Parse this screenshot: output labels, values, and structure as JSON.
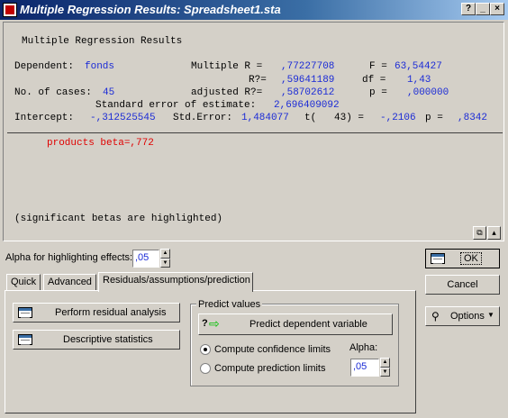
{
  "window": {
    "title": "Multiple Regression Results: Spreadsheet1.sta",
    "buttons": {
      "help": "?",
      "minimize": "_",
      "close": "×"
    }
  },
  "output": {
    "heading": "Multiple Regression Results",
    "dependent_label": "Dependent:",
    "dependent_value": "fonds",
    "multiple_r_label": "Multiple R =",
    "multiple_r_value": ",77227708",
    "f_label": "F =",
    "f_value": "63,54427",
    "r2_label": "R?=",
    "r2_value": ",59641189",
    "df_label": "df =",
    "df_value": "1,43",
    "cases_label": "No. of cases:",
    "cases_value": "45",
    "adj_r2_label": "adjusted R?=",
    "adj_r2_value": ",58702612",
    "p_label": "p =",
    "p_value": ",000000",
    "std_err_est_label": "Standard error of estimate:",
    "std_err_est_value": "2,696409092",
    "intercept_label": "Intercept:",
    "intercept_value": "-,312525545",
    "std_error_label": "Std.Error:",
    "std_error_value": "1,484077",
    "t_label": "t(   43) =",
    "t_value": "-,2106",
    "p2_label": "p =",
    "p2_value": ",8342",
    "beta_line": "products beta=,772",
    "footnote": "(significant betas are highlighted)"
  },
  "alpha_highlight": {
    "label": "Alpha for highlighting effects:",
    "value": ",05"
  },
  "tabs": [
    {
      "label": "Quick",
      "active": false
    },
    {
      "label": "Advanced",
      "active": false
    },
    {
      "label": "Residuals/assumptions/prediction",
      "active": true
    }
  ],
  "buttons": {
    "residual": "Perform residual analysis",
    "descriptive": "Descriptive statistics",
    "predict": "Predict dependent variable",
    "ok": "OK",
    "cancel": "Cancel",
    "options": "Options"
  },
  "predict_group": {
    "title": "Predict values",
    "confidence": "Compute confidence limits",
    "prediction": "Compute prediction limits",
    "selected": "confidence",
    "alpha_label": "Alpha:",
    "alpha_value": ",05"
  },
  "colors": {
    "value_blue": "#1b2bd6",
    "beta_red": "#e00000",
    "title_start": "#0a246a",
    "title_end": "#a6caf0"
  }
}
